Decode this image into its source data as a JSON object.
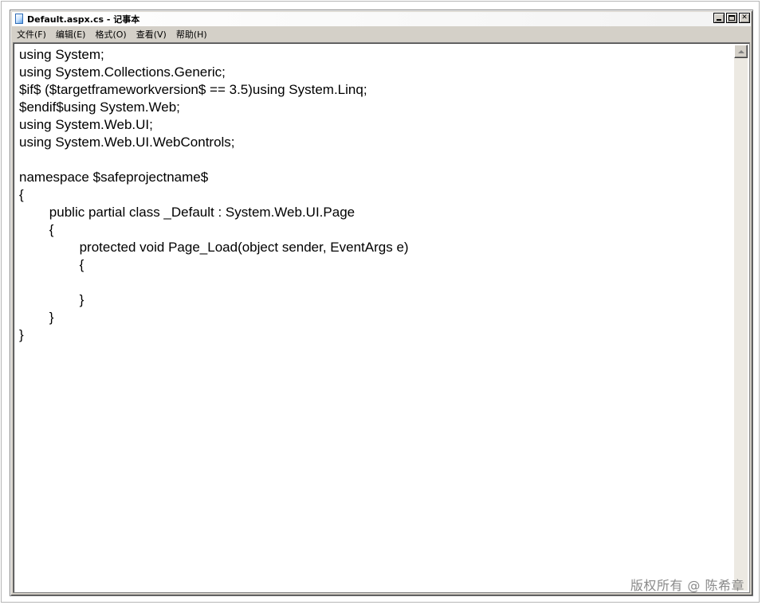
{
  "window": {
    "title": "Default.aspx.cs - 记事本"
  },
  "menu": [
    {
      "label": "文件(F)"
    },
    {
      "label": "编辑(E)"
    },
    {
      "label": "格式(O)"
    },
    {
      "label": "查看(V)"
    },
    {
      "label": "帮助(H)"
    }
  ],
  "editor": {
    "content": "using System;\nusing System.Collections.Generic;\n$if$ ($targetframeworkversion$ == 3.5)using System.Linq;\n$endif$using System.Web;\nusing System.Web.UI;\nusing System.Web.UI.WebControls;\n\nnamespace $safeprojectname$\n{\n\tpublic partial class _Default : System.Web.UI.Page\n\t{\n\t\tprotected void Page_Load(object sender, EventArgs e)\n\t\t{\n\n\t\t}\n\t}\n}"
  },
  "watermark": "版权所有 @ 陈希章",
  "icons": {
    "app": "notepad-icon",
    "minimize": "minimize-icon",
    "maximize": "maximize-icon",
    "close": "close-icon",
    "scroll_up": "scroll-up-arrow-icon"
  }
}
